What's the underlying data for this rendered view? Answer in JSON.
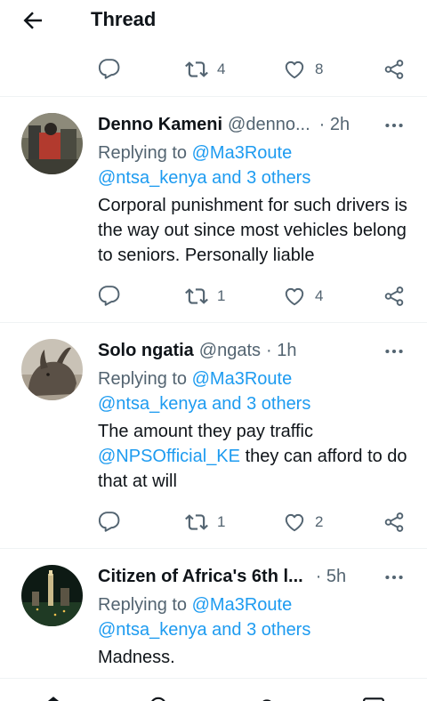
{
  "header": {
    "title": "Thread"
  },
  "top_actions": {
    "retweets": "4",
    "likes": "8"
  },
  "tweets": [
    {
      "name": "Denno Kameni",
      "handle": "@denno...",
      "time": "· 2h",
      "replying_prefix": "Replying to",
      "reply_mention": "@Ma3Route",
      "reply_others": "@ntsa_kenya and 3 others",
      "text": "Corporal punishment for such drivers is the way out since most vehicles belong to seniors.  Personally liable",
      "retweets": "1",
      "likes": "4"
    },
    {
      "name": "Solo ngatia",
      "handle": "@ngats",
      "time": "· 1h",
      "replying_prefix": "Replying to",
      "reply_mention": "@Ma3Route",
      "reply_others": "@ntsa_kenya and 3 others",
      "text_before": "The amount they pay traffic",
      "text_link": "@NPSOfficial_KE",
      "text_after": "they can afford to do that at will",
      "retweets": "1",
      "likes": "2"
    },
    {
      "name": "Citizen of Africa's 6th l...",
      "time": "· 5h",
      "replying_prefix": "Replying to",
      "reply_mention": "@Ma3Route",
      "reply_others": "@ntsa_kenya and 3 others",
      "text": "Madness."
    }
  ],
  "colors": {
    "link": "#1d9bf0",
    "muted": "#536471",
    "text": "#0f1419",
    "divider": "#eff3f4"
  }
}
